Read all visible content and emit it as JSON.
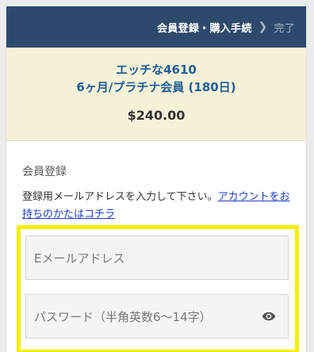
{
  "header": {
    "steps": [
      {
        "label": "会員登録・購入手続",
        "state": "active"
      },
      {
        "label": "完了",
        "state": "inactive"
      }
    ],
    "separator_icon": "chevron-right-icon",
    "background_color": "#2d4a6d"
  },
  "product": {
    "name": "エッチな4610",
    "plan": "6ヶ月/プラチナ会員 (180日)",
    "price": "$240.00",
    "background_color": "#f6f1d9"
  },
  "registration": {
    "title": "会員登録",
    "instruction": "登録用メールアドレスを入力して下さい。",
    "account_link": "アカウントをお持ちのかたはコチラ",
    "email_placeholder": "Eメールアドレス",
    "password_placeholder": "パスワード（半角英数6〜14字）",
    "password_toggle_icon": "eye-icon"
  },
  "highlight_color": "#f5f000"
}
